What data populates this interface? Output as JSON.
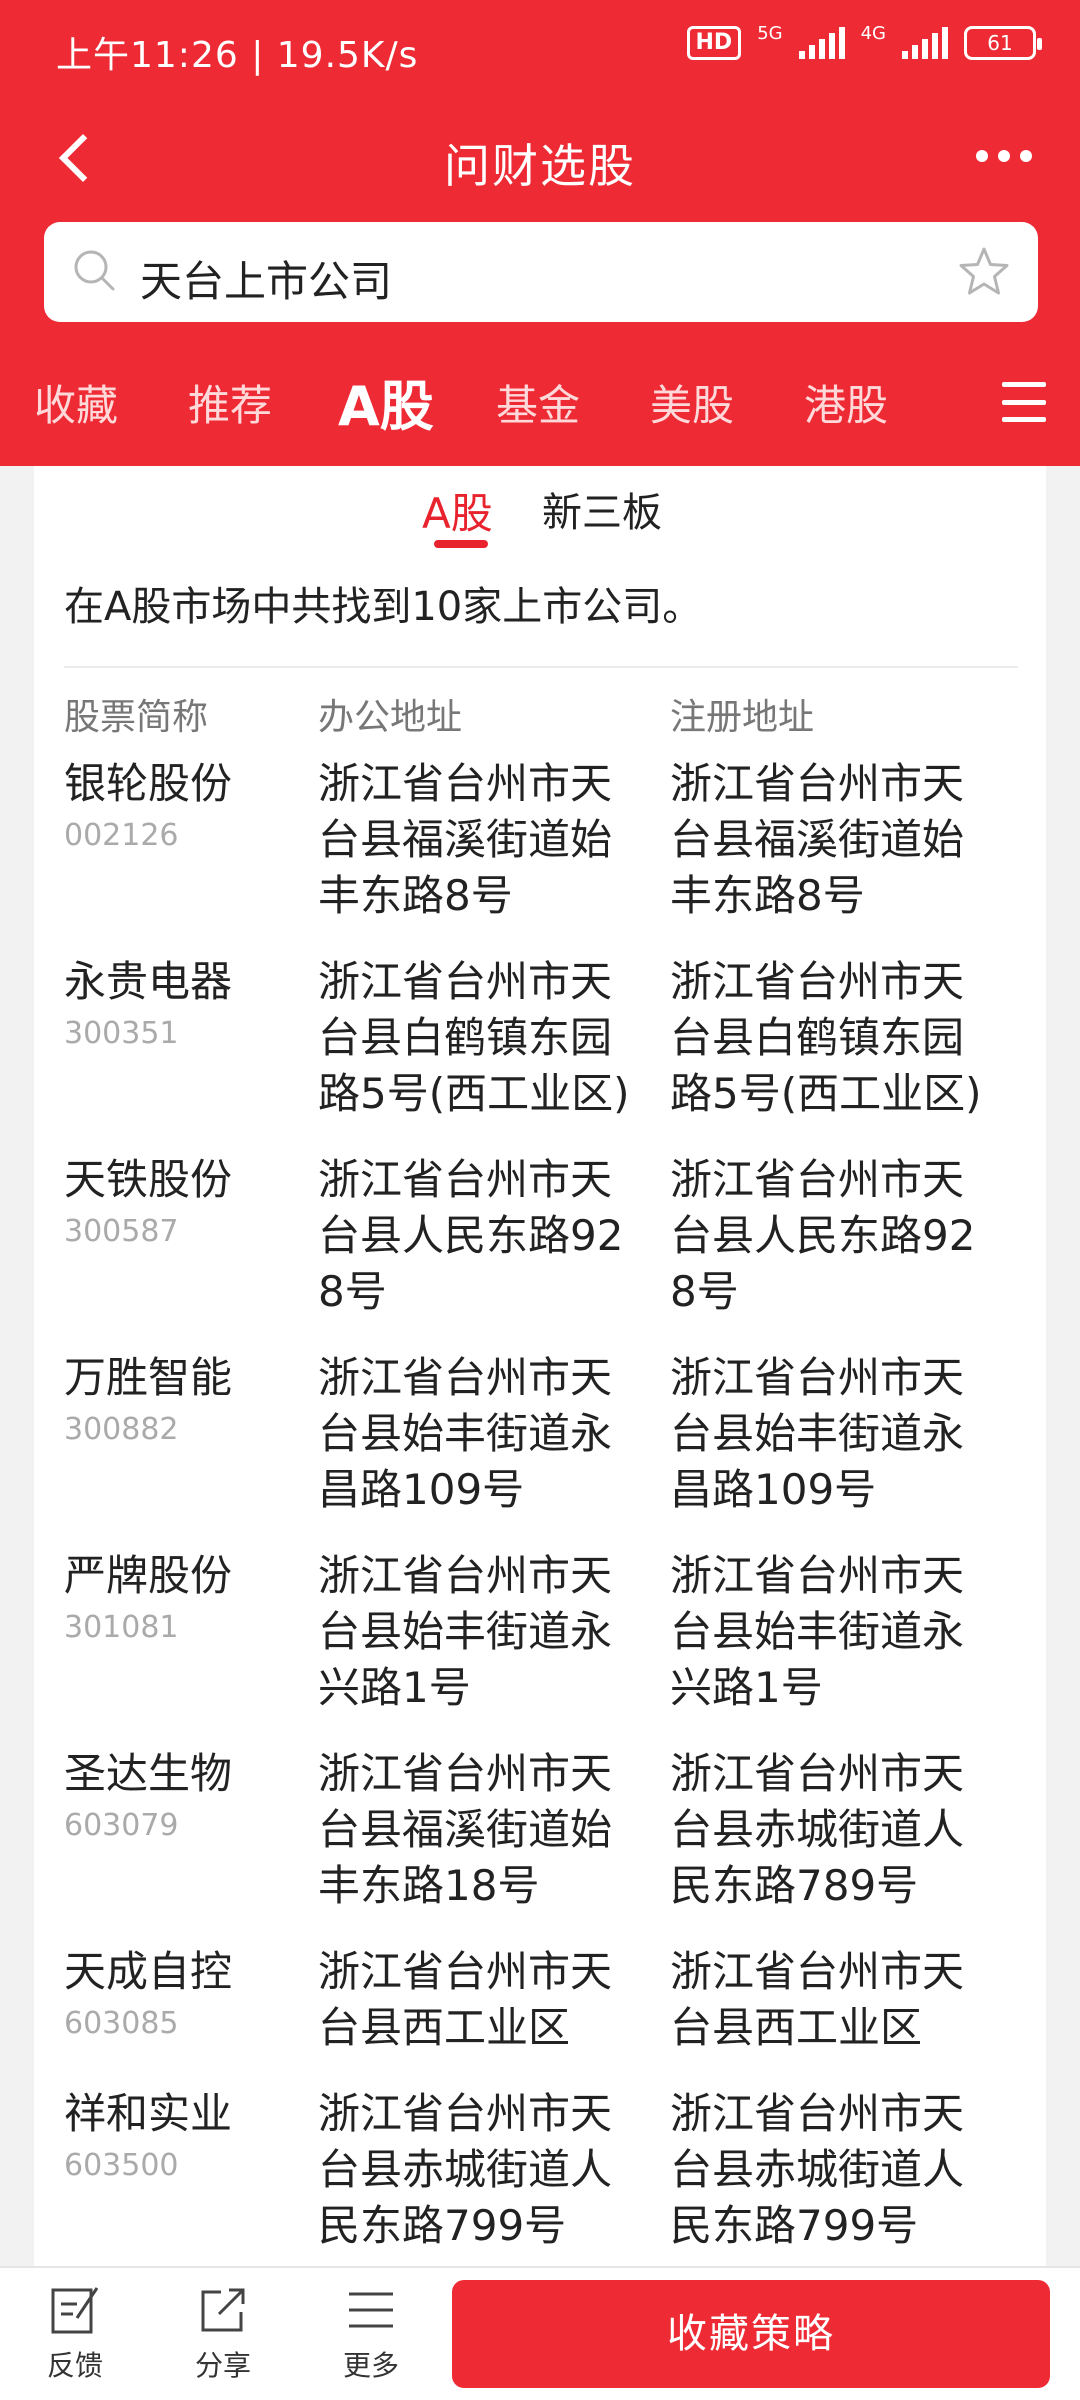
{
  "status": {
    "time_speed": "上午11:26 | 19.5K/s",
    "hd": "HD",
    "net1": "5G",
    "net2": "4G",
    "battery": "61"
  },
  "nav": {
    "title": "问财选股"
  },
  "search": {
    "query": "天台上市公司"
  },
  "tabs": [
    "收藏",
    "推荐",
    "A股",
    "基金",
    "美股",
    "港股"
  ],
  "active_tab": "A股",
  "subtabs": [
    "A股",
    "新三板"
  ],
  "summary": "在A股市场中共找到10家上市公司。",
  "columns": [
    "股票简称",
    "办公地址",
    "注册地址"
  ],
  "rows": [
    {
      "name": "银轮股份",
      "code": "002126",
      "office": "浙江省台州市天台县福溪街道始丰东路8号",
      "registered": "浙江省台州市天台县福溪街道始丰东路8号"
    },
    {
      "name": "永贵电器",
      "code": "300351",
      "office": "浙江省台州市天台县白鹤镇东园路5号(西工业区)",
      "registered": "浙江省台州市天台县白鹤镇东园路5号(西工业区)"
    },
    {
      "name": "天铁股份",
      "code": "300587",
      "office": "浙江省台州市天台县人民东路928号",
      "registered": "浙江省台州市天台县人民东路928号"
    },
    {
      "name": "万胜智能",
      "code": "300882",
      "office": "浙江省台州市天台县始丰街道永昌路109号",
      "registered": "浙江省台州市天台县始丰街道永昌路109号"
    },
    {
      "name": "严牌股份",
      "code": "301081",
      "office": "浙江省台州市天台县始丰街道永兴路1号",
      "registered": "浙江省台州市天台县始丰街道永兴路1号"
    },
    {
      "name": "圣达生物",
      "code": "603079",
      "office": "浙江省台州市天台县福溪街道始丰东路18号",
      "registered": "浙江省台州市天台县赤城街道人民东路789号"
    },
    {
      "name": "天成自控",
      "code": "603085",
      "office": "浙江省台州市天台县西工业区",
      "registered": "浙江省台州市天台县西工业区"
    },
    {
      "name": "祥和实业",
      "code": "603500",
      "office": "浙江省台州市天台县赤城街道人民东路799号",
      "registered": "浙江省台州市天台县赤城街道人民东路799号"
    }
  ],
  "bottom": {
    "feedback": "反馈",
    "share": "分享",
    "more": "更多",
    "collect": "收藏策略"
  },
  "colors": {
    "brand_red": "#ee2a34",
    "active_red": "#e8232d"
  }
}
